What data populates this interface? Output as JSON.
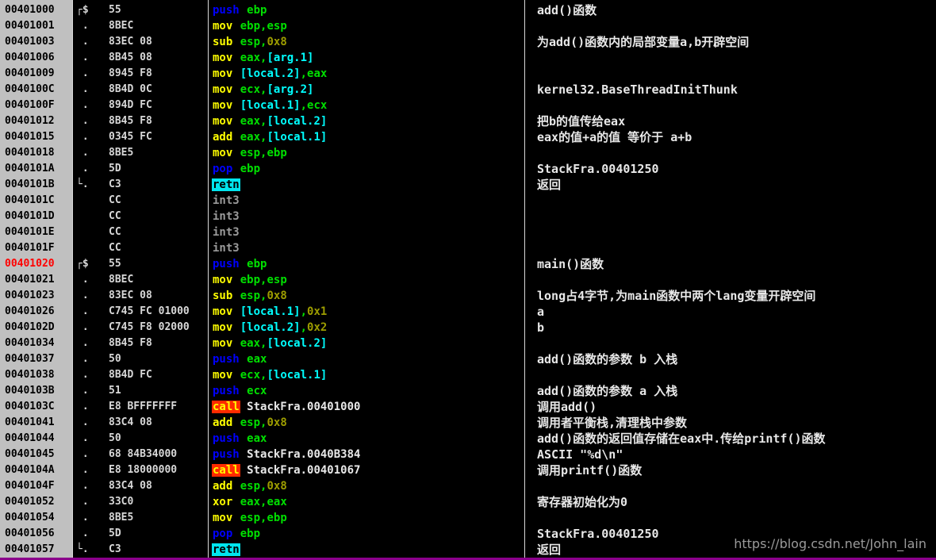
{
  "rows": [
    {
      "addr": "00401000",
      "mark": "┌$",
      "hex": "55",
      "asm": [
        {
          "t": "push",
          "c": "push"
        },
        {
          "t": " "
        },
        {
          "t": "ebp",
          "c": "reg"
        }
      ],
      "comment": "add()函数"
    },
    {
      "addr": "00401001",
      "mark": " .",
      "hex": "8BEC",
      "asm": [
        {
          "t": "mov",
          "c": "mov"
        },
        {
          "t": " "
        },
        {
          "t": "ebp",
          "c": "reg"
        },
        {
          "t": ",",
          "c": "reg"
        },
        {
          "t": "esp",
          "c": "reg"
        }
      ],
      "comment": ""
    },
    {
      "addr": "00401003",
      "mark": " .",
      "hex": "83EC 08",
      "asm": [
        {
          "t": "sub",
          "c": "arith"
        },
        {
          "t": " "
        },
        {
          "t": "esp",
          "c": "reg"
        },
        {
          "t": ",",
          "c": "reg"
        },
        {
          "t": "0x8",
          "c": "imm"
        }
      ],
      "comment": "为add()函数内的局部变量a,b开辟空间"
    },
    {
      "addr": "00401006",
      "mark": " .",
      "hex": "8B45 08",
      "asm": [
        {
          "t": "mov",
          "c": "mov"
        },
        {
          "t": " "
        },
        {
          "t": "eax",
          "c": "reg"
        },
        {
          "t": ",",
          "c": "reg"
        },
        {
          "t": "[arg.1]",
          "c": "mem"
        }
      ],
      "comment": ""
    },
    {
      "addr": "00401009",
      "mark": " .",
      "hex": "8945 F8",
      "asm": [
        {
          "t": "mov",
          "c": "mov"
        },
        {
          "t": " "
        },
        {
          "t": "[local.2]",
          "c": "mem"
        },
        {
          "t": ",",
          "c": "reg"
        },
        {
          "t": "eax",
          "c": "reg"
        }
      ],
      "comment": ""
    },
    {
      "addr": "0040100C",
      "mark": " .",
      "hex": "8B4D 0C",
      "asm": [
        {
          "t": "mov",
          "c": "mov"
        },
        {
          "t": " "
        },
        {
          "t": "ecx",
          "c": "reg"
        },
        {
          "t": ",",
          "c": "reg"
        },
        {
          "t": "[arg.2]",
          "c": "mem"
        }
      ],
      "comment": "kernel32.BaseThreadInitThunk"
    },
    {
      "addr": "0040100F",
      "mark": " .",
      "hex": "894D FC",
      "asm": [
        {
          "t": "mov",
          "c": "mov"
        },
        {
          "t": " "
        },
        {
          "t": "[local.1]",
          "c": "mem"
        },
        {
          "t": ",",
          "c": "reg"
        },
        {
          "t": "ecx",
          "c": "reg"
        }
      ],
      "comment": ""
    },
    {
      "addr": "00401012",
      "mark": " .",
      "hex": "8B45 F8",
      "asm": [
        {
          "t": "mov",
          "c": "mov"
        },
        {
          "t": " "
        },
        {
          "t": "eax",
          "c": "reg"
        },
        {
          "t": ",",
          "c": "reg"
        },
        {
          "t": "[local.2]",
          "c": "mem"
        }
      ],
      "comment": "把b的值传给eax"
    },
    {
      "addr": "00401015",
      "mark": " .",
      "hex": "0345 FC",
      "asm": [
        {
          "t": "add",
          "c": "arith"
        },
        {
          "t": " "
        },
        {
          "t": "eax",
          "c": "reg"
        },
        {
          "t": ",",
          "c": "reg"
        },
        {
          "t": "[local.1]",
          "c": "mem"
        }
      ],
      "comment": "eax的值+a的值 等价于 a+b"
    },
    {
      "addr": "00401018",
      "mark": " .",
      "hex": "8BE5",
      "asm": [
        {
          "t": "mov",
          "c": "mov"
        },
        {
          "t": " "
        },
        {
          "t": "esp",
          "c": "reg"
        },
        {
          "t": ",",
          "c": "reg"
        },
        {
          "t": "ebp",
          "c": "reg"
        }
      ],
      "comment": ""
    },
    {
      "addr": "0040101A",
      "mark": " .",
      "hex": "5D",
      "asm": [
        {
          "t": "pop",
          "c": "push"
        },
        {
          "t": " "
        },
        {
          "t": "ebp",
          "c": "reg"
        }
      ],
      "comment": "StackFra.00401250"
    },
    {
      "addr": "0040101B",
      "mark": "└.",
      "hex": "C3",
      "asm": [
        {
          "t": "retn",
          "c": "retn"
        }
      ],
      "comment": "返回"
    },
    {
      "addr": "0040101C",
      "mark": "",
      "hex": "CC",
      "asm": [
        {
          "t": "int3",
          "c": "int"
        }
      ],
      "comment": ""
    },
    {
      "addr": "0040101D",
      "mark": "",
      "hex": "CC",
      "asm": [
        {
          "t": "int3",
          "c": "int"
        }
      ],
      "comment": ""
    },
    {
      "addr": "0040101E",
      "mark": "",
      "hex": "CC",
      "asm": [
        {
          "t": "int3",
          "c": "int"
        }
      ],
      "comment": ""
    },
    {
      "addr": "0040101F",
      "mark": "",
      "hex": "CC",
      "asm": [
        {
          "t": "int3",
          "c": "int"
        }
      ],
      "comment": ""
    },
    {
      "addr": "00401020",
      "mark": "┌$",
      "hex": "55",
      "asm": [
        {
          "t": "push",
          "c": "push"
        },
        {
          "t": " "
        },
        {
          "t": "ebp",
          "c": "reg"
        }
      ],
      "comment": "main()函数",
      "current": true
    },
    {
      "addr": "00401021",
      "mark": " .",
      "hex": "8BEC",
      "asm": [
        {
          "t": "mov",
          "c": "mov"
        },
        {
          "t": " "
        },
        {
          "t": "ebp",
          "c": "reg"
        },
        {
          "t": ",",
          "c": "reg"
        },
        {
          "t": "esp",
          "c": "reg"
        }
      ],
      "comment": ""
    },
    {
      "addr": "00401023",
      "mark": " .",
      "hex": "83EC 08",
      "asm": [
        {
          "t": "sub",
          "c": "arith"
        },
        {
          "t": " "
        },
        {
          "t": "esp",
          "c": "reg"
        },
        {
          "t": ",",
          "c": "reg"
        },
        {
          "t": "0x8",
          "c": "imm"
        }
      ],
      "comment": "long占4字节,为main函数中两个lang变量开辟空间"
    },
    {
      "addr": "00401026",
      "mark": " .",
      "hex": "C745 FC 01000",
      "asm": [
        {
          "t": "mov",
          "c": "mov"
        },
        {
          "t": " "
        },
        {
          "t": "[local.1]",
          "c": "mem"
        },
        {
          "t": ",",
          "c": "reg"
        },
        {
          "t": "0x1",
          "c": "imm"
        }
      ],
      "comment": "a"
    },
    {
      "addr": "0040102D",
      "mark": " .",
      "hex": "C745 F8 02000",
      "asm": [
        {
          "t": "mov",
          "c": "mov"
        },
        {
          "t": " "
        },
        {
          "t": "[local.2]",
          "c": "mem"
        },
        {
          "t": ",",
          "c": "reg"
        },
        {
          "t": "0x2",
          "c": "imm"
        }
      ],
      "comment": "b"
    },
    {
      "addr": "00401034",
      "mark": " .",
      "hex": "8B45 F8",
      "asm": [
        {
          "t": "mov",
          "c": "mov"
        },
        {
          "t": " "
        },
        {
          "t": "eax",
          "c": "reg"
        },
        {
          "t": ",",
          "c": "reg"
        },
        {
          "t": "[local.2]",
          "c": "mem"
        }
      ],
      "comment": ""
    },
    {
      "addr": "00401037",
      "mark": " .",
      "hex": "50",
      "asm": [
        {
          "t": "push",
          "c": "push"
        },
        {
          "t": " "
        },
        {
          "t": "eax",
          "c": "reg"
        }
      ],
      "comment": "add()函数的参数 b 入栈"
    },
    {
      "addr": "00401038",
      "mark": " .",
      "hex": "8B4D FC",
      "asm": [
        {
          "t": "mov",
          "c": "mov"
        },
        {
          "t": " "
        },
        {
          "t": "ecx",
          "c": "reg"
        },
        {
          "t": ",",
          "c": "reg"
        },
        {
          "t": "[local.1]",
          "c": "mem"
        }
      ],
      "comment": ""
    },
    {
      "addr": "0040103B",
      "mark": " .",
      "hex": "51",
      "asm": [
        {
          "t": "push",
          "c": "push"
        },
        {
          "t": " "
        },
        {
          "t": "ecx",
          "c": "reg"
        }
      ],
      "comment": "add()函数的参数 a 入栈"
    },
    {
      "addr": "0040103C",
      "mark": " .",
      "hex": "E8 BFFFFFFF",
      "asm": [
        {
          "t": "call",
          "c": "call"
        },
        {
          "t": " "
        },
        {
          "t": "StackFra.00401000",
          "c": "plain"
        }
      ],
      "comment": "调用add()"
    },
    {
      "addr": "00401041",
      "mark": " .",
      "hex": "83C4 08",
      "asm": [
        {
          "t": "add",
          "c": "arith"
        },
        {
          "t": " "
        },
        {
          "t": "esp",
          "c": "reg"
        },
        {
          "t": ",",
          "c": "reg"
        },
        {
          "t": "0x8",
          "c": "imm"
        }
      ],
      "comment": "调用者平衡栈,清理栈中参数"
    },
    {
      "addr": "00401044",
      "mark": " .",
      "hex": "50",
      "asm": [
        {
          "t": "push",
          "c": "push"
        },
        {
          "t": " "
        },
        {
          "t": "eax",
          "c": "reg"
        }
      ],
      "comment": "add()函数的返回值存储在eax中.传给printf()函数"
    },
    {
      "addr": "00401045",
      "mark": " .",
      "hex": "68 84B34000",
      "asm": [
        {
          "t": "push",
          "c": "push"
        },
        {
          "t": " "
        },
        {
          "t": "StackFra.0040B384",
          "c": "plain"
        }
      ],
      "comment": "ASCII \"%d\\n\""
    },
    {
      "addr": "0040104A",
      "mark": " .",
      "hex": "E8 18000000",
      "asm": [
        {
          "t": "call",
          "c": "call"
        },
        {
          "t": " "
        },
        {
          "t": "StackFra.00401067",
          "c": "plain"
        }
      ],
      "comment": "调用printf()函数"
    },
    {
      "addr": "0040104F",
      "mark": " .",
      "hex": "83C4 08",
      "asm": [
        {
          "t": "add",
          "c": "arith"
        },
        {
          "t": " "
        },
        {
          "t": "esp",
          "c": "reg"
        },
        {
          "t": ",",
          "c": "reg"
        },
        {
          "t": "0x8",
          "c": "imm"
        }
      ],
      "comment": ""
    },
    {
      "addr": "00401052",
      "mark": " .",
      "hex": "33C0",
      "asm": [
        {
          "t": "xor",
          "c": "arith"
        },
        {
          "t": " "
        },
        {
          "t": "eax",
          "c": "reg"
        },
        {
          "t": ",",
          "c": "reg"
        },
        {
          "t": "eax",
          "c": "reg"
        }
      ],
      "comment": "寄存器初始化为0"
    },
    {
      "addr": "00401054",
      "mark": " .",
      "hex": "8BE5",
      "asm": [
        {
          "t": "mov",
          "c": "mov"
        },
        {
          "t": " "
        },
        {
          "t": "esp",
          "c": "reg"
        },
        {
          "t": ",",
          "c": "reg"
        },
        {
          "t": "ebp",
          "c": "reg"
        }
      ],
      "comment": ""
    },
    {
      "addr": "00401056",
      "mark": " .",
      "hex": "5D",
      "asm": [
        {
          "t": "pop",
          "c": "push"
        },
        {
          "t": " "
        },
        {
          "t": "ebp",
          "c": "reg"
        }
      ],
      "comment": "StackFra.00401250"
    },
    {
      "addr": "00401057",
      "mark": "└.",
      "hex": "C3",
      "asm": [
        {
          "t": "retn",
          "c": "retn"
        }
      ],
      "comment": "返回"
    }
  ],
  "watermark": "https://blog.csdn.net/John_lain",
  "colors": {
    "background": "#000000",
    "address_column": "#c0c0c0",
    "current_address": "#ff0000",
    "push_pop": "#0000ff",
    "mov_arith": "#ffff00",
    "register": "#00e000",
    "memory_operand": "#00ffff",
    "immediate": "#9d9d00",
    "retn_highlight": "#00e5ee",
    "call_highlight": "#ff2a00",
    "bottom_bar": "#8b008b"
  }
}
